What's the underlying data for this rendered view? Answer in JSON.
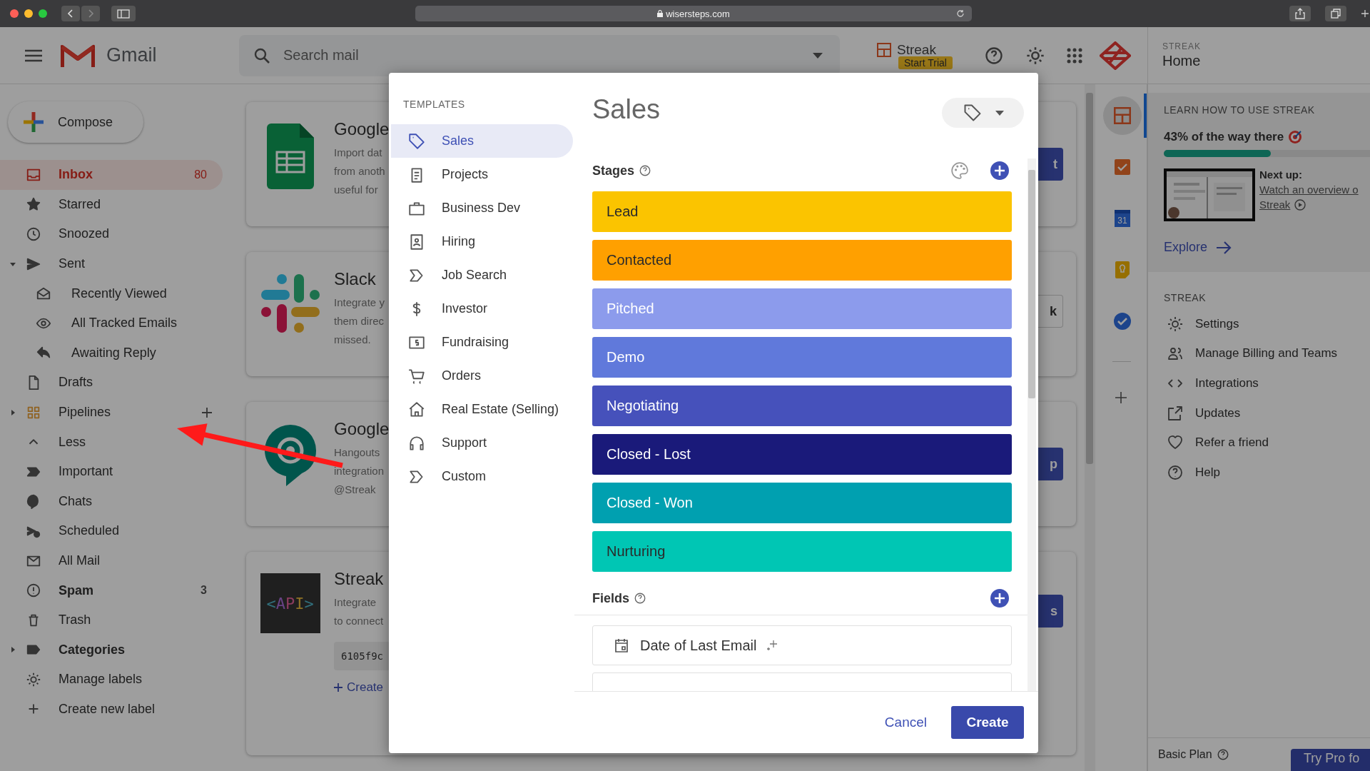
{
  "browser": {
    "url": "wisersteps.com"
  },
  "header": {
    "app_name": "Gmail",
    "search": {
      "placeholder": "Search mail"
    },
    "streak_button": {
      "label": "Streak",
      "badge": "Start Trial"
    }
  },
  "compose": {
    "label": "Compose"
  },
  "sidebar": {
    "items": [
      {
        "label": "Inbox",
        "count": "80",
        "selected": true,
        "unread": true
      },
      {
        "label": "Starred",
        "selected": false,
        "unread": false
      },
      {
        "label": "Snoozed",
        "selected": false,
        "unread": false
      },
      {
        "label": "Sent",
        "selected": false,
        "unread": false,
        "expanded": true,
        "children": [
          {
            "label": "Recently Viewed",
            "selected": false,
            "unread": false
          },
          {
            "label": "All Tracked Emails",
            "selected": false,
            "unread": false
          },
          {
            "label": "Awaiting Reply",
            "selected": false,
            "unread": false
          }
        ]
      },
      {
        "label": "Drafts",
        "selected": false,
        "unread": false
      },
      {
        "label": "Pipelines",
        "selected": false,
        "unread": false,
        "expanded": false,
        "add_button": true
      },
      {
        "label": "Less",
        "selected": false,
        "unread": false
      },
      {
        "label": "Important",
        "selected": false,
        "unread": false
      },
      {
        "label": "Chats",
        "selected": false,
        "unread": false
      },
      {
        "label": "Scheduled",
        "selected": false,
        "unread": false
      },
      {
        "label": "All Mail",
        "selected": false,
        "unread": false
      },
      {
        "label": "Spam",
        "count": "3",
        "selected": false,
        "unread": true
      },
      {
        "label": "Trash",
        "selected": false,
        "unread": false
      },
      {
        "label": "Categories",
        "selected": false,
        "unread": true,
        "expanded": false
      },
      {
        "label": "Manage labels",
        "selected": false,
        "unread": false
      },
      {
        "label": "Create new label",
        "selected": false,
        "unread": false
      }
    ]
  },
  "cards": [
    {
      "title": "Google",
      "lines": [
        "Import dat",
        "from anoth",
        "useful for"
      ],
      "button": "t",
      "kind": "filled"
    },
    {
      "title": "Slack",
      "lines": [
        "Integrate y",
        "them direc",
        "missed."
      ],
      "button": "k",
      "kind": "outlined"
    },
    {
      "title": "Google",
      "lines": [
        "Hangouts",
        "integration",
        "@Streak"
      ],
      "button": "p",
      "kind": "filled"
    },
    {
      "title": "Streak",
      "logo_text": "<API>",
      "lines": [
        "Integrate",
        "to connect"
      ],
      "code": "6105f9c",
      "link": "Create",
      "button": "s",
      "kind": "filled"
    }
  ],
  "side_apps": [
    {
      "selected": true
    },
    {
      "selected": false
    },
    {
      "selected": false,
      "label": "31"
    },
    {
      "selected": false
    },
    {
      "selected": false
    }
  ],
  "streak_panel": {
    "overline": "STREAK",
    "title": "Home",
    "learn": {
      "heading": "LEARN HOW TO USE STREAK",
      "progress_text": "43% of the way there",
      "level": 0.43,
      "next_label": "Next up:",
      "next_link_lines": [
        "Watch an overview o",
        "Streak"
      ],
      "explore": "Explore"
    },
    "section": "STREAK",
    "menu": [
      "Settings",
      "Manage Billing and Teams",
      "Integrations",
      "Updates",
      "Refer a friend",
      "Help"
    ],
    "plan": "Basic Plan",
    "pro_button": "Try Pro fo"
  },
  "modal": {
    "templates_heading": "TEMPLATES",
    "templates": [
      {
        "label": "Sales",
        "selected": true
      },
      {
        "label": "Projects",
        "selected": false
      },
      {
        "label": "Business Dev",
        "selected": false
      },
      {
        "label": "Hiring",
        "selected": false
      },
      {
        "label": "Job Search",
        "selected": false
      },
      {
        "label": "Investor",
        "selected": false
      },
      {
        "label": "Fundraising",
        "selected": false
      },
      {
        "label": "Orders",
        "selected": false
      },
      {
        "label": "Real Estate (Selling)",
        "selected": false
      },
      {
        "label": "Support",
        "selected": false
      },
      {
        "label": "Custom",
        "selected": false
      }
    ],
    "title": "Sales",
    "stages_label": "Stages",
    "stages": [
      {
        "name": "Lead",
        "color": "#fbc400"
      },
      {
        "name": "Contacted",
        "color": "#ffa000"
      },
      {
        "name": "Pitched",
        "color": "#8c9bec"
      },
      {
        "name": "Demo",
        "color": "#6079db"
      },
      {
        "name": "Negotiating",
        "color": "#4651bb"
      },
      {
        "name": "Closed - Lost",
        "color": "#1a1a7a"
      },
      {
        "name": "Closed - Won",
        "color": "#00a0b0"
      },
      {
        "name": "Nurturing",
        "color": "#00c6b4"
      }
    ],
    "fields_label": "Fields",
    "fields": [
      "Date of Last Email"
    ],
    "cancel": "Cancel",
    "create": "Create"
  }
}
